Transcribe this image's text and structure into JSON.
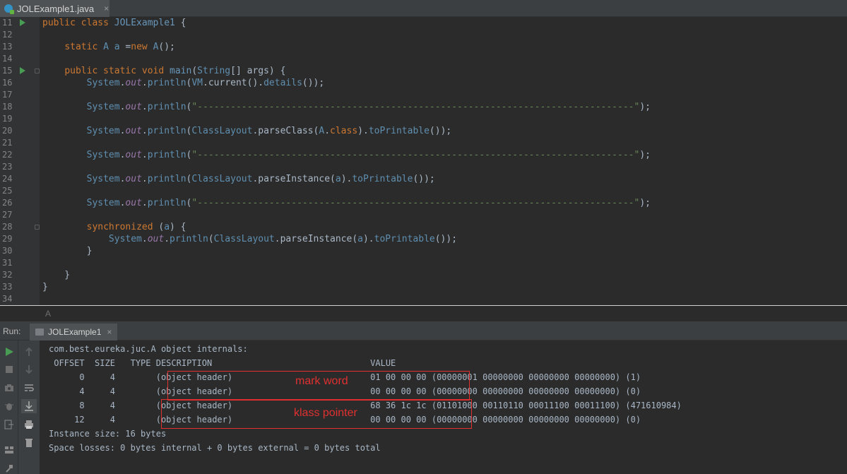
{
  "tab": {
    "file_name": "JOLExample1.java",
    "close": "×"
  },
  "code_lines": [
    {
      "num": "11",
      "html": "<span class=\"kw\">public class </span><span class=\"typ\">JOLExample1</span> {",
      "run": true,
      "fold": false
    },
    {
      "num": "12",
      "html": "",
      "run": false,
      "fold": false
    },
    {
      "num": "13",
      "html": "    <span class=\"kw\">static </span><span class=\"ty\">A</span> <span class=\"ty\">a</span> =<span class=\"kw\">new </span><span class=\"ty\">A</span>();",
      "run": false,
      "fold": false
    },
    {
      "num": "14",
      "html": "",
      "run": false,
      "fold": false
    },
    {
      "num": "15",
      "html": "    <span class=\"kw\">public static void </span><span class=\"typ\">main</span>(<span class=\"ty\">String</span>[] args) {",
      "run": true,
      "fold": true
    },
    {
      "num": "16",
      "html": "        <span class=\"ty\">System</span>.<span class=\"fld\">out</span>.<span class=\"ty\">println</span>(<span class=\"ty\">VM</span>.current().<span class=\"ty\">details</span>());",
      "run": false,
      "fold": false
    },
    {
      "num": "17",
      "html": "",
      "run": false,
      "fold": false
    },
    {
      "num": "18",
      "html": "        <span class=\"ty\">System</span>.<span class=\"fld\">out</span>.<span class=\"ty\">println</span>(<span class=\"str\">\"-------------------------------------------------------------------------------\"</span>);",
      "run": false,
      "fold": false
    },
    {
      "num": "19",
      "html": "",
      "run": false,
      "fold": false
    },
    {
      "num": "20",
      "html": "        <span class=\"ty\">System</span>.<span class=\"fld\">out</span>.<span class=\"ty\">println</span>(<span class=\"ty\">ClassLayout</span>.parseClass(<span class=\"ty\">A</span>.<span class=\"kw\">class</span>).<span class=\"ty\">toPrintable</span>());",
      "run": false,
      "fold": false
    },
    {
      "num": "21",
      "html": "",
      "run": false,
      "fold": false
    },
    {
      "num": "22",
      "html": "        <span class=\"ty\">System</span>.<span class=\"fld\">out</span>.<span class=\"ty\">println</span>(<span class=\"str\">\"-------------------------------------------------------------------------------\"</span>);",
      "run": false,
      "fold": false
    },
    {
      "num": "23",
      "html": "",
      "run": false,
      "fold": false
    },
    {
      "num": "24",
      "html": "        <span class=\"ty\">System</span>.<span class=\"fld\">out</span>.<span class=\"ty\">println</span>(<span class=\"ty\">ClassLayout</span>.parseInstance(<span class=\"ty\">a</span>).<span class=\"ty\">toPrintable</span>());",
      "run": false,
      "fold": false
    },
    {
      "num": "25",
      "html": "",
      "run": false,
      "fold": false
    },
    {
      "num": "26",
      "html": "        <span class=\"ty\">System</span>.<span class=\"fld\">out</span>.<span class=\"ty\">println</span>(<span class=\"str\">\"-------------------------------------------------------------------------------\"</span>);",
      "run": false,
      "fold": false
    },
    {
      "num": "27",
      "html": "",
      "run": false,
      "fold": false
    },
    {
      "num": "28",
      "html": "        <span class=\"kw\">synchronized </span>(<span class=\"ty\">a</span>) {",
      "run": false,
      "fold": true
    },
    {
      "num": "29",
      "html": "            <span class=\"ty\">System</span>.<span class=\"fld\">out</span>.<span class=\"ty\">println</span>(<span class=\"ty\">ClassLayout</span>.parseInstance(<span class=\"ty\">a</span>).<span class=\"ty\">toPrintable</span>());",
      "run": false,
      "fold": false
    },
    {
      "num": "30",
      "html": "        }",
      "run": false,
      "fold": false
    },
    {
      "num": "31",
      "html": "",
      "run": false,
      "fold": false
    },
    {
      "num": "32",
      "html": "    }",
      "run": false,
      "fold": false
    },
    {
      "num": "33",
      "html": "}",
      "run": false,
      "fold": false
    },
    {
      "num": "34",
      "html": "",
      "run": false,
      "fold": false
    }
  ],
  "breadcrumb": "A",
  "run_panel": {
    "label": "Run:",
    "tab_label": "JOLExample1",
    "close": "×"
  },
  "console_lines": [
    "com.best.eureka.juc.A object internals:",
    " OFFSET  SIZE   TYPE DESCRIPTION                               VALUE",
    "      0     4        (object header)                           01 00 00 00 (00000001 00000000 00000000 00000000) (1)",
    "      4     4        (object header)                           00 00 00 00 (00000000 00000000 00000000 00000000) (0)",
    "      8     4        (object header)                           68 36 1c 1c (01101000 00110110 00011100 00011100) (471610984)",
    "     12     4        (object header)                           00 00 00 00 (00000000 00000000 00000000 00000000) (0)",
    "Instance size: 16 bytes",
    "Space losses: 0 bytes internal + 0 bytes external = 0 bytes total"
  ],
  "annotations": {
    "mark_word": "mark word",
    "klass_pointer": "klass pointer"
  },
  "colors": {
    "annotation": "#e03030",
    "keyword": "#cc7832",
    "string": "#6a8759",
    "field": "#9876aa"
  }
}
